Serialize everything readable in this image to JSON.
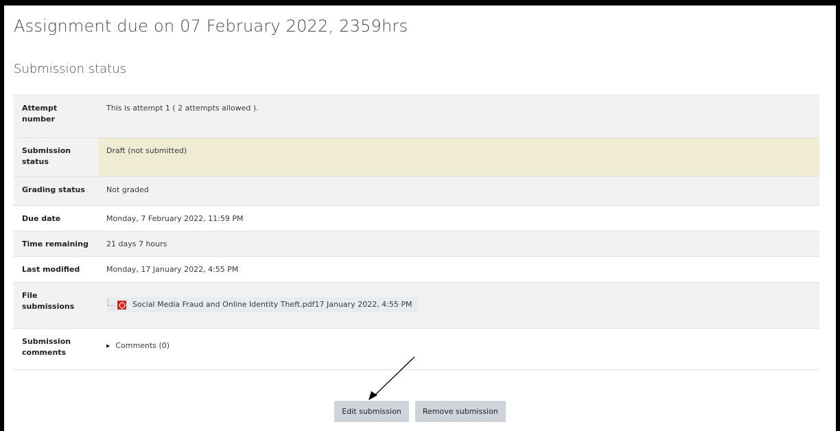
{
  "page": {
    "title": "Assignment due on 07 February 2022, 2359hrs",
    "section_title": "Submission status"
  },
  "status": {
    "attempt_label": "Attempt number",
    "attempt_value": "This is attempt 1 ( 2 attempts allowed ).",
    "submission_label": "Submission status",
    "submission_value": "Draft (not submitted)",
    "grading_label": "Grading status",
    "grading_value": "Not graded",
    "due_label": "Due date",
    "due_value": "Monday, 7 February 2022, 11:59 PM",
    "remaining_label": "Time remaining",
    "remaining_value": "21 days 7 hours",
    "modified_label": "Last modified",
    "modified_value": "Monday, 17 January 2022, 4:55 PM",
    "files_label": "File submissions",
    "file_name": "Social Media Fraud and Online Identity Theft.pdf",
    "file_date": "17 January 2022, 4:55 PM",
    "comments_label": "Submission comments",
    "comments_link": "Comments (0)"
  },
  "buttons": {
    "edit": "Edit submission",
    "remove": "Remove submission"
  },
  "icons": {
    "file": "pdf-file-icon",
    "toggle": "caret-right-icon",
    "annotation": "arrow-annotation"
  },
  "colors": {
    "draft_highlight": "#efecd3",
    "row_grey": "#f2f2f2",
    "button_bg": "#ced4da",
    "pdf_red": "#d9231f"
  }
}
